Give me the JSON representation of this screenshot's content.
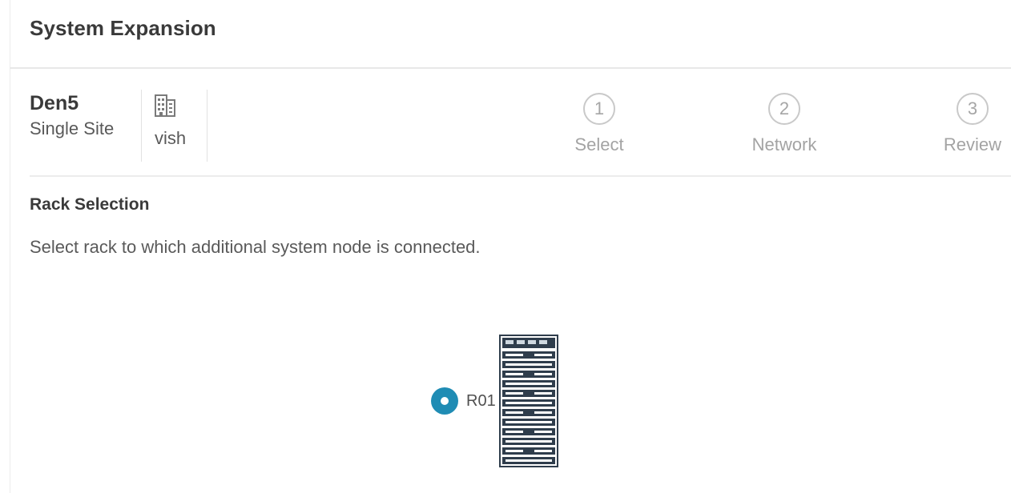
{
  "header": {
    "title": "System Expansion"
  },
  "site": {
    "name": "Den5",
    "type": "Single Site",
    "owner_icon": "building-icon",
    "owner": "vish"
  },
  "wizard": {
    "steps": [
      {
        "number": "1",
        "label": "Select"
      },
      {
        "number": "2",
        "label": "Network"
      },
      {
        "number": "3",
        "label": "Review"
      }
    ]
  },
  "rack_selection": {
    "title": "Rack Selection",
    "description": "Select rack to which additional system node is connected.",
    "racks": [
      {
        "label": "R01",
        "selected": true,
        "icon": "server-rack-icon"
      }
    ]
  },
  "colors": {
    "accent": "#1f8cb4",
    "rack": "#2f3d4c"
  }
}
